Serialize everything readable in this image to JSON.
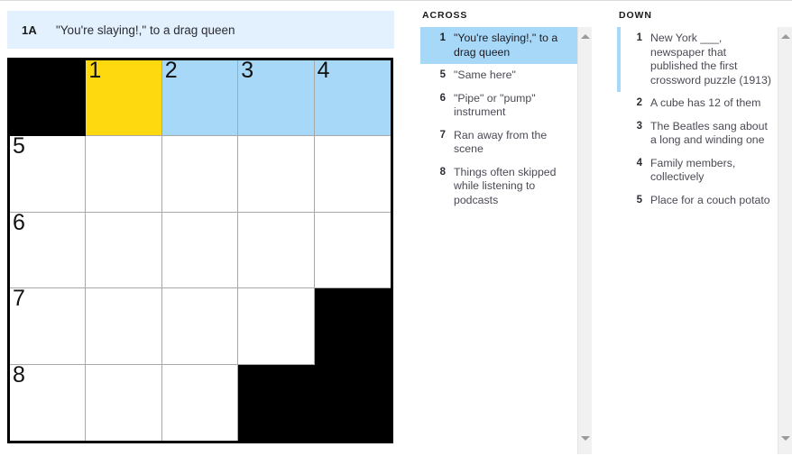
{
  "current_clue": {
    "number": "1A",
    "text": "\"You're slaying!,\" to a drag queen"
  },
  "colors": {
    "cursor_cell": "#ffd90f",
    "highlight_cell": "#a8d8f8",
    "block_cell": "#000000",
    "clue_bar_bg": "#e2f1fd",
    "selected_clue_bg": "#a8d8f8"
  },
  "grid": {
    "rows": 5,
    "cols": 5,
    "cells": [
      [
        {
          "type": "block",
          "num": "",
          "letter": "",
          "state": "block"
        },
        {
          "type": "open",
          "num": "1",
          "letter": "",
          "state": "cursor"
        },
        {
          "type": "open",
          "num": "2",
          "letter": "",
          "state": "highlight"
        },
        {
          "type": "open",
          "num": "3",
          "letter": "",
          "state": "highlight"
        },
        {
          "type": "open",
          "num": "4",
          "letter": "",
          "state": "highlight"
        }
      ],
      [
        {
          "type": "open",
          "num": "5",
          "letter": "",
          "state": "normal"
        },
        {
          "type": "open",
          "num": "",
          "letter": "",
          "state": "normal"
        },
        {
          "type": "open",
          "num": "",
          "letter": "",
          "state": "normal"
        },
        {
          "type": "open",
          "num": "",
          "letter": "",
          "state": "normal"
        },
        {
          "type": "open",
          "num": "",
          "letter": "",
          "state": "normal"
        }
      ],
      [
        {
          "type": "open",
          "num": "6",
          "letter": "",
          "state": "normal"
        },
        {
          "type": "open",
          "num": "",
          "letter": "",
          "state": "normal"
        },
        {
          "type": "open",
          "num": "",
          "letter": "",
          "state": "normal"
        },
        {
          "type": "open",
          "num": "",
          "letter": "",
          "state": "normal"
        },
        {
          "type": "open",
          "num": "",
          "letter": "",
          "state": "normal"
        }
      ],
      [
        {
          "type": "open",
          "num": "7",
          "letter": "",
          "state": "normal"
        },
        {
          "type": "open",
          "num": "",
          "letter": "",
          "state": "normal"
        },
        {
          "type": "open",
          "num": "",
          "letter": "",
          "state": "normal"
        },
        {
          "type": "open",
          "num": "",
          "letter": "",
          "state": "normal"
        },
        {
          "type": "block",
          "num": "",
          "letter": "",
          "state": "block"
        }
      ],
      [
        {
          "type": "open",
          "num": "8",
          "letter": "",
          "state": "normal"
        },
        {
          "type": "open",
          "num": "",
          "letter": "",
          "state": "normal"
        },
        {
          "type": "open",
          "num": "",
          "letter": "",
          "state": "normal"
        },
        {
          "type": "block",
          "num": "",
          "letter": "",
          "state": "block"
        },
        {
          "type": "block",
          "num": "",
          "letter": "",
          "state": "block"
        }
      ]
    ]
  },
  "across": {
    "heading": "ACROSS",
    "clues": [
      {
        "num": "1",
        "text": "\"You're slaying!,\" to a drag queen",
        "state": "selected"
      },
      {
        "num": "5",
        "text": "\"Same here\"",
        "state": "normal"
      },
      {
        "num": "6",
        "text": "\"Pipe\" or \"pump\" instrument",
        "state": "normal"
      },
      {
        "num": "7",
        "text": "Ran away from the scene",
        "state": "normal"
      },
      {
        "num": "8",
        "text": "Things often skipped while listening to podcasts",
        "state": "normal"
      }
    ]
  },
  "down": {
    "heading": "DOWN",
    "clues": [
      {
        "num": "1",
        "text": "New York ___, newspaper that published the first crossword puzzle (1913)",
        "state": "xref"
      },
      {
        "num": "2",
        "text": "A cube has 12 of them",
        "state": "normal"
      },
      {
        "num": "3",
        "text": "The Beatles sang about a long and winding one",
        "state": "normal"
      },
      {
        "num": "4",
        "text": "Family members, collectively",
        "state": "normal"
      },
      {
        "num": "5",
        "text": "Place for a couch potato",
        "state": "normal"
      }
    ]
  },
  "scrollbars": {
    "across": {
      "up_icon": "triangle-up-icon",
      "down_icon": "triangle-down-icon"
    },
    "down": {
      "up_icon": "triangle-up-icon",
      "down_icon": "triangle-down-icon"
    }
  }
}
